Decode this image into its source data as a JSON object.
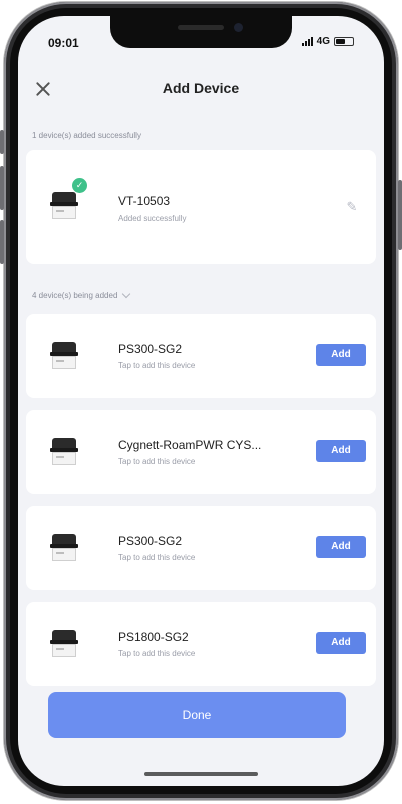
{
  "status_bar": {
    "time": "09:01",
    "network": "4G"
  },
  "header": {
    "title": "Add Device",
    "close_icon": "close-icon"
  },
  "added_section": {
    "label": "1 device(s) added successfully",
    "devices": [
      {
        "name": "VT-10503",
        "subtitle": "Added successfully",
        "icon": "device-icon",
        "badge": "check-icon",
        "action_icon": "edit-icon"
      }
    ]
  },
  "pending_section": {
    "label": "4 device(s) being added",
    "devices": [
      {
        "name": "PS300-SG2",
        "subtitle": "Tap to add this device",
        "button": "Add"
      },
      {
        "name": "Cygnett-RoamPWR CYS...",
        "subtitle": "Tap to add this device",
        "button": "Add"
      },
      {
        "name": "PS300-SG2",
        "subtitle": "Tap to add this device",
        "button": "Add"
      },
      {
        "name": "PS1800-SG2",
        "subtitle": "Tap to add this device",
        "button": "Add"
      }
    ]
  },
  "footer": {
    "done_label": "Done"
  },
  "colors": {
    "accent": "#5e84e8",
    "success": "#3fc18a",
    "background": "#f2f3f7"
  }
}
